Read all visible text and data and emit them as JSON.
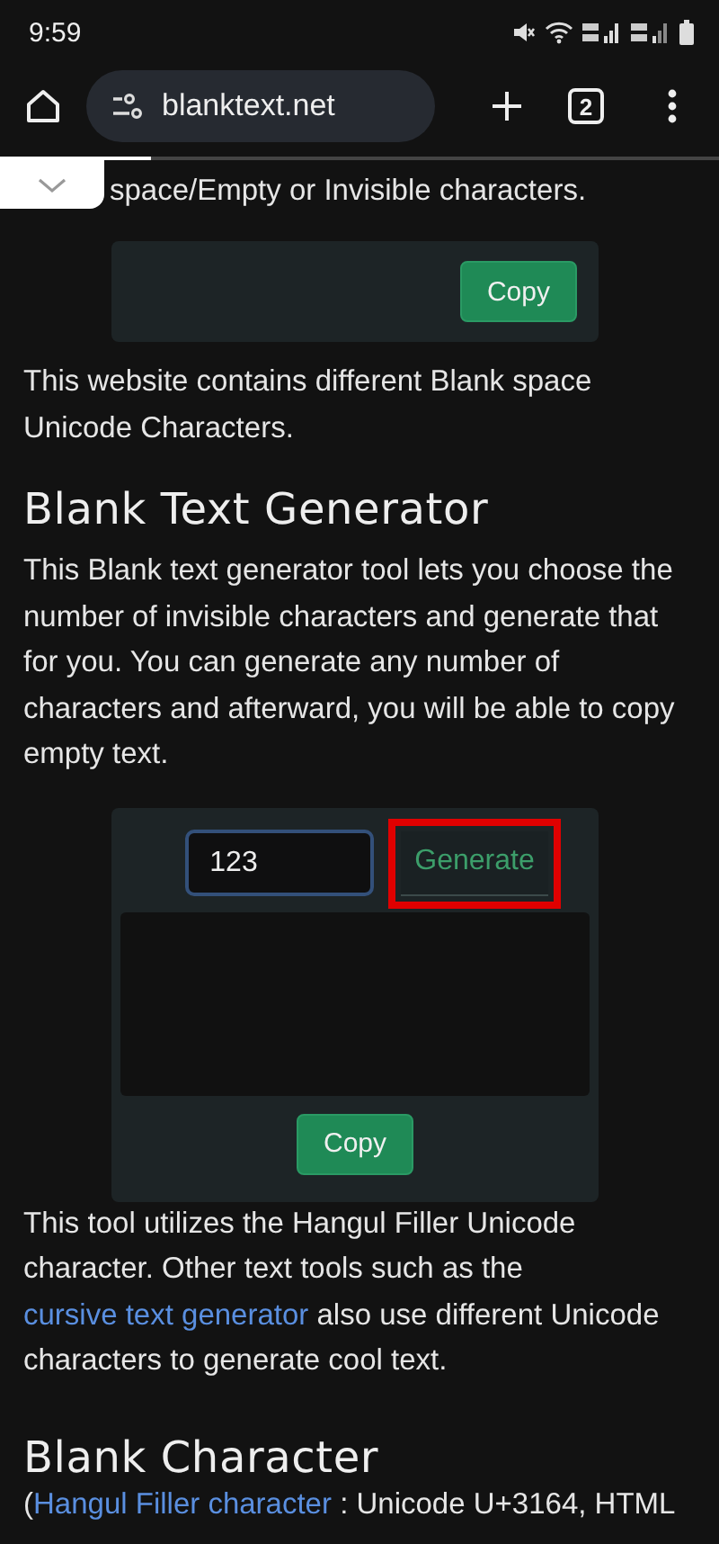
{
  "status_bar": {
    "time": "9:59"
  },
  "browser": {
    "url": "blanktext.net",
    "tab_count": "2",
    "level": 0.21
  },
  "page": {
    "partial_line": "space/Empty or Invisible characters.",
    "copy_card": {
      "button": "Copy"
    },
    "intro": "This website contains different Blank space Unicode Characters.",
    "heading": "Blank Text Generator",
    "description": "This Blank text generator tool lets you choose the number of invisible characters and generate that for you. You can generate any number of characters and afterward, you will be able to copy empty text.",
    "generator": {
      "count_value": "123",
      "generate_button": "Generate",
      "generate_highlighted": true,
      "copy_button": "Copy"
    },
    "note": {
      "before": "This tool utilizes the Hangul Filler Unicode character. Other text tools such as the ",
      "link": "cursive text generator",
      "after": " also use different Unicode characters to generate cool text."
    },
    "heading_2": "Blank Character",
    "last_line": {
      "open": "(",
      "link": "Hangul Filler character",
      "rest": " : Unicode U+3164, HTML"
    }
  }
}
